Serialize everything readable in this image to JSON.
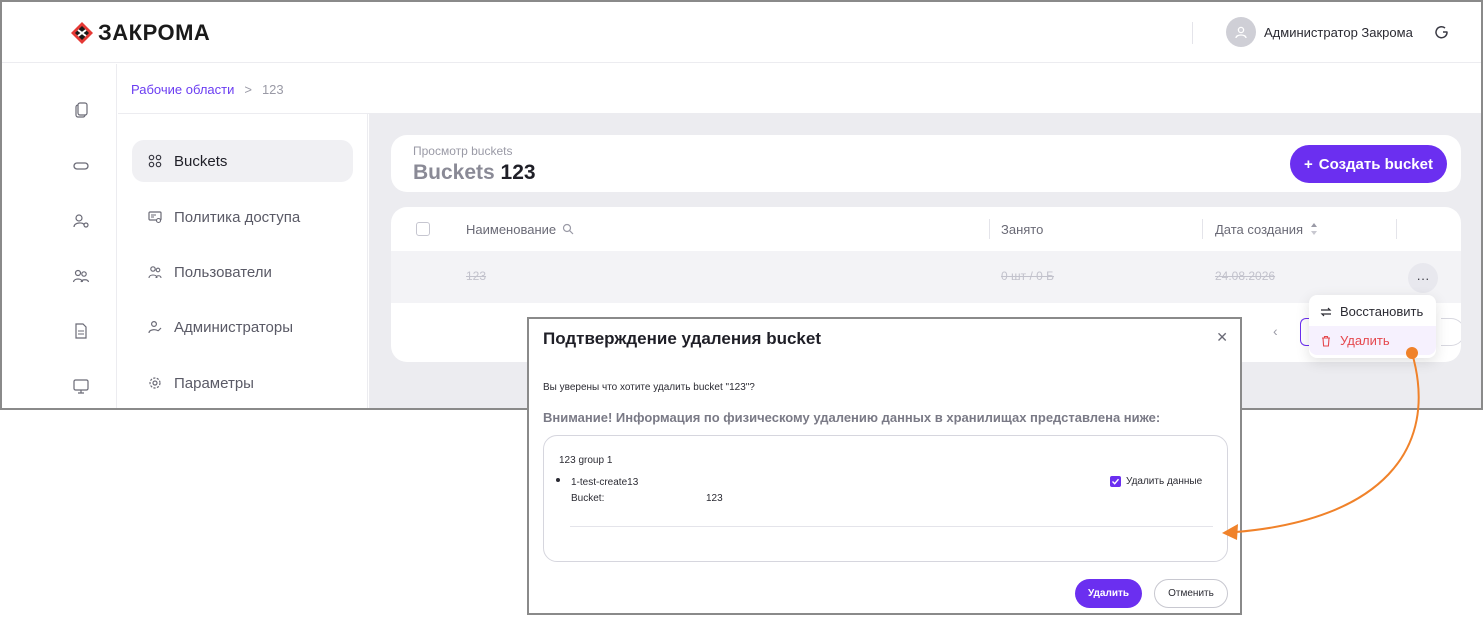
{
  "brand": {
    "name": "ЗАКРОМА",
    "accent": "#6b2ff0"
  },
  "header": {
    "user_name": "Администратор Закрома"
  },
  "breadcrumb": {
    "root": "Рабочие области",
    "separator": ">",
    "current": "123"
  },
  "rail_icons": [
    "documents-icon",
    "storage-icon",
    "user-settings-icon",
    "users-icon",
    "file-icon",
    "monitor-icon"
  ],
  "sidenav": {
    "items": [
      {
        "label": "Buckets",
        "icon": "buckets-icon",
        "active": true
      },
      {
        "label": "Политика доступа",
        "icon": "policy-icon"
      },
      {
        "label": "Пользователи",
        "icon": "users-icon"
      },
      {
        "label": "Администраторы",
        "icon": "admin-icon"
      },
      {
        "label": "Параметры",
        "icon": "gear-icon"
      }
    ]
  },
  "page": {
    "subtitle": "Просмотр buckets",
    "title": "Buckets",
    "title_num": "123",
    "create_button": "Создать bucket"
  },
  "table": {
    "columns": [
      "Наименование",
      "Занято",
      "Дата создания"
    ],
    "row": {
      "name": "123",
      "size": "0 шт / 0 Б",
      "date": "24.08.2026",
      "more": "···"
    }
  },
  "dropdown": {
    "restore": "Восстановить",
    "delete": "Удалить"
  },
  "modal": {
    "title": "Подтверждение удаления bucket",
    "question": "Вы уверены что хотите удалить bucket \"123\"?",
    "warning": "Внимание! Информация по физическому удалению данных в хранилищах представлена ниже:",
    "group": "123 group 1",
    "item_name": "1-test-create13",
    "item_key": "Bucket:",
    "item_value": "123",
    "checkbox_label": "Удалить данные",
    "checkbox_checked": true,
    "delete_button": "Удалить",
    "cancel_button": "Отменить"
  },
  "colors": {
    "danger": "#e5484d",
    "annotation": "#f0822a"
  }
}
